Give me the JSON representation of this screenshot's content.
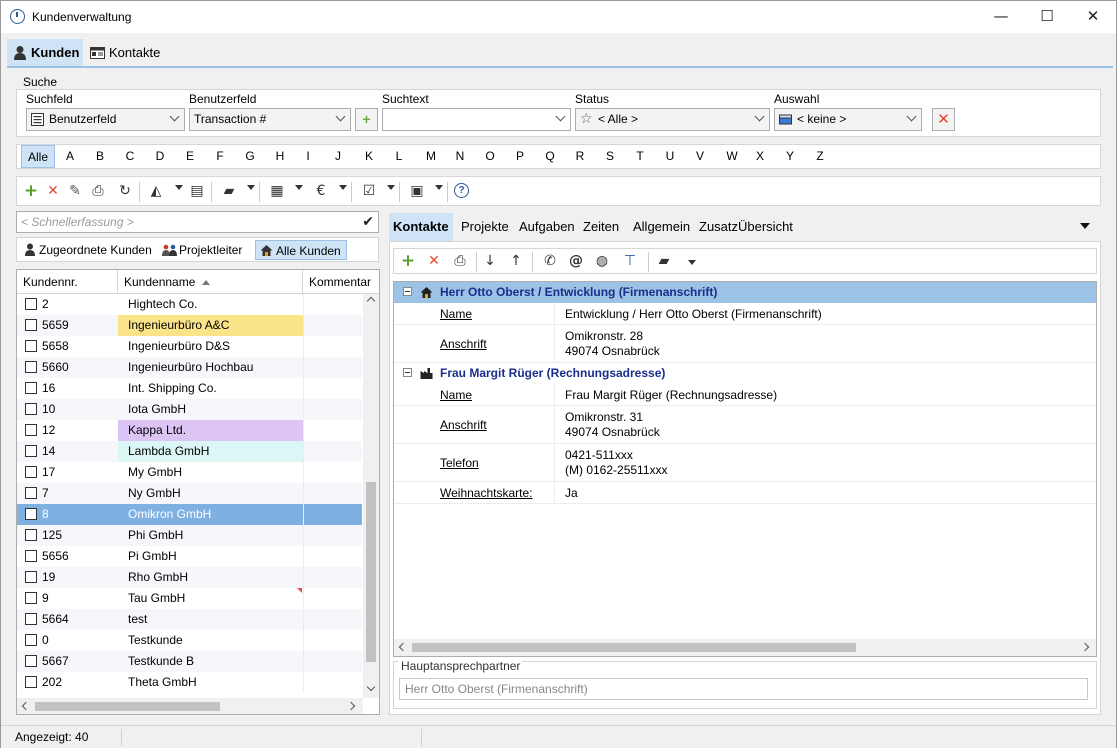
{
  "window": {
    "title": "Kundenverwaltung",
    "minimize": "—",
    "maximize": "☐",
    "close": "✕"
  },
  "main_tabs": [
    {
      "label": "Kunden"
    },
    {
      "label": "Kontakte"
    }
  ],
  "search": {
    "group_label": "Suche",
    "suchfeld": {
      "label": "Suchfeld",
      "value": "Benutzerfeld"
    },
    "benutzerfeld": {
      "label": "Benutzerfeld",
      "value": "Transaction #"
    },
    "suchtext": {
      "label": "Suchtext",
      "value": ""
    },
    "status": {
      "label": "Status",
      "value": "< Alle >"
    },
    "auswahl": {
      "label": "Auswahl",
      "value": "< keine >"
    }
  },
  "alphabet": [
    "Alle",
    "A",
    "B",
    "C",
    "D",
    "E",
    "F",
    "G",
    "H",
    "I",
    "J",
    "K",
    "L",
    "M",
    "N",
    "O",
    "P",
    "Q",
    "R",
    "S",
    "T",
    "U",
    "V",
    "W",
    "X",
    "Y",
    "Z"
  ],
  "quick_entry": {
    "placeholder": "< Schnellerfassung >"
  },
  "customer_tabs": [
    {
      "label": "Zugeordnete Kunden"
    },
    {
      "label": "Projektleiter"
    },
    {
      "label": "Alle Kunden"
    }
  ],
  "grid": {
    "columns": [
      "Kundennr.",
      "Kundenname",
      "Kommentar"
    ],
    "rows": [
      {
        "nr": "2",
        "name": "Hightech Co.",
        "color": ""
      },
      {
        "nr": "5659",
        "name": "Ingenieurbüro A&C",
        "color": "#fbe38a"
      },
      {
        "nr": "5658",
        "name": "Ingenieurbüro D&S",
        "color": ""
      },
      {
        "nr": "5660",
        "name": "Ingenieurbüro Hochbau",
        "color": ""
      },
      {
        "nr": "16",
        "name": "Int. Shipping Co.",
        "color": ""
      },
      {
        "nr": "10",
        "name": "Iota GmbH",
        "color": ""
      },
      {
        "nr": "12",
        "name": "Kappa Ltd.",
        "color": "#dcc4f4"
      },
      {
        "nr": "14",
        "name": "Lambda GmbH",
        "color": "#dcf6f6"
      },
      {
        "nr": "17",
        "name": "My GmbH",
        "color": ""
      },
      {
        "nr": "7",
        "name": "Ny GmbH",
        "color": ""
      },
      {
        "nr": "8",
        "name": "Omikron GmbH",
        "color": ""
      },
      {
        "nr": "125",
        "name": "Phi GmbH",
        "color": ""
      },
      {
        "nr": "5656",
        "name": "Pi GmbH",
        "color": ""
      },
      {
        "nr": "19",
        "name": "Rho GmbH",
        "color": ""
      },
      {
        "nr": "9",
        "name": "Tau GmbH",
        "color": ""
      },
      {
        "nr": "5664",
        "name": "test",
        "color": ""
      },
      {
        "nr": "0",
        "name": "Testkunde",
        "color": ""
      },
      {
        "nr": "5667",
        "name": "Testkunde B",
        "color": ""
      },
      {
        "nr": "202",
        "name": "Theta GmbH",
        "color": ""
      }
    ]
  },
  "right_tabs": [
    {
      "label": "Kontakte"
    },
    {
      "label": "Projekte"
    },
    {
      "label": "Aufgaben"
    },
    {
      "label": "Zeiten"
    },
    {
      "label": "Allgemein"
    },
    {
      "label": "Zusatz"
    },
    {
      "label": "Übersicht"
    }
  ],
  "contacts": [
    {
      "title": "Herr Otto Oberst / Entwicklung (Firmenanschrift)",
      "props": [
        {
          "key": "Name",
          "lines": [
            "Entwicklung / Herr Otto Oberst (Firmenanschrift)"
          ]
        },
        {
          "key": "Anschrift",
          "lines": [
            "Omikronstr. 28",
            "49074 Osnabrück"
          ]
        }
      ]
    },
    {
      "title": "Frau Margit Rüger (Rechnungsadresse)",
      "props": [
        {
          "key": "Name",
          "lines": [
            "Frau Margit Rüger (Rechnungsadresse)"
          ]
        },
        {
          "key": "Anschrift",
          "lines": [
            "Omikronstr. 31",
            "49074 Osnabrück"
          ]
        },
        {
          "key": "Telefon",
          "lines": [
            "0421-511xxx",
            "(M) 0162-25511xxx"
          ]
        },
        {
          "key": "Weihnachtskarte:",
          "lines": [
            "Ja"
          ]
        }
      ]
    }
  ],
  "hauptansprechpartner": {
    "label": "Hauptansprechpartner",
    "value": "Herr Otto Oberst (Firmenanschrift)"
  },
  "status_bar": {
    "text": "Angezeigt: 40"
  }
}
